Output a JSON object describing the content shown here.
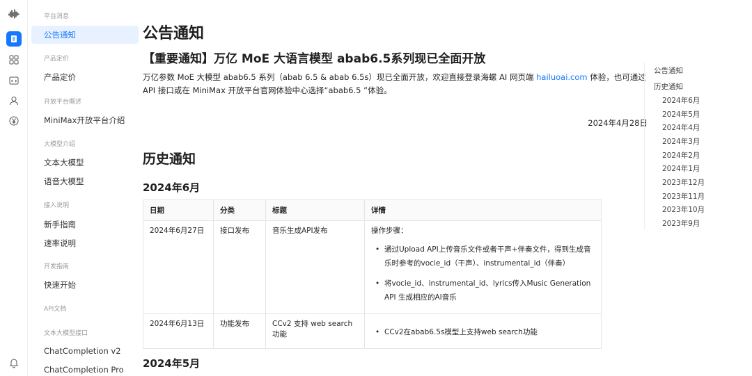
{
  "rail": {
    "icons": [
      "waveform-logo-icon",
      "document-icon",
      "grid-icon",
      "code-icon",
      "user-icon",
      "yen-icon",
      "bell-icon"
    ]
  },
  "sidebar": {
    "groups": [
      {
        "label": "平台消息"
      },
      {
        "label": "产品定价"
      },
      {
        "label": "开放平台概述"
      },
      {
        "label": "大模型介绍"
      },
      {
        "label": "接入说明"
      },
      {
        "label": "开发指南"
      },
      {
        "label": "API文档"
      },
      {
        "label": "文本大模型接口"
      }
    ],
    "items": [
      {
        "label": "公告通知"
      },
      {
        "label": "产品定价"
      },
      {
        "label": "MiniMax开放平台介绍"
      },
      {
        "label": "文本大模型"
      },
      {
        "label": "语音大模型"
      },
      {
        "label": "新手指南"
      },
      {
        "label": "速率说明"
      },
      {
        "label": "快速开始"
      },
      {
        "label": "ChatCompletion v2"
      },
      {
        "label": "ChatCompletion Pro"
      }
    ]
  },
  "main": {
    "title": "公告通知",
    "headline": "【重要通知】万亿 MoE 大语言模型 abab6.5系列现已全面开放",
    "para_before": "万亿参数 MoE 大模型 abab6.5 系列（abab 6.5 & abab 6.5s）现已全面开放，欢迎直接登录海螺 AI 网页端 ",
    "para_link": "hailuoai.com",
    "para_after": " 体验，也可通过 API 接口或在 MiniMax 开放平台官网体验中心选择“abab6.5 ”体验。",
    "date": "2024年4月28日",
    "history_title": "历史通知",
    "month1": "2024年6月",
    "month2": "2024年5月",
    "table": {
      "headers": [
        "日期",
        "分类",
        "标题",
        "详情"
      ],
      "rows": [
        {
          "date": "2024年6月27日",
          "category": "接口发布",
          "title": "音乐生成API发布",
          "detail_title": "操作步骤：",
          "bullets": [
            "通过Upload API上传音乐文件或者干声+伴奏文件，得到生成音乐时参考的vocie_id（干声）、instrumental_id（伴奏）",
            "将vocie_id、instrumental_id、lyrics传入Music Generation API 生成相应的AI音乐"
          ]
        },
        {
          "date": "2024年6月13日",
          "category": "功能发布",
          "title": "CCv2 支持 web search功能",
          "bullets": [
            "CCv2在abab6.5s模型上支持web search功能"
          ]
        }
      ]
    }
  },
  "toc": {
    "items": [
      {
        "label": "公告通知"
      },
      {
        "label": "历史通知"
      },
      {
        "label": "2024年6月"
      },
      {
        "label": "2024年5月"
      },
      {
        "label": "2024年4月"
      },
      {
        "label": "2024年3月"
      },
      {
        "label": "2024年2月"
      },
      {
        "label": "2024年1月"
      },
      {
        "label": "2023年12月"
      },
      {
        "label": "2023年11月"
      },
      {
        "label": "2023年10月"
      },
      {
        "label": "2023年9月"
      }
    ]
  },
  "colors": {
    "accent": "#1677ff",
    "active_bg": "#e8f1ff"
  }
}
